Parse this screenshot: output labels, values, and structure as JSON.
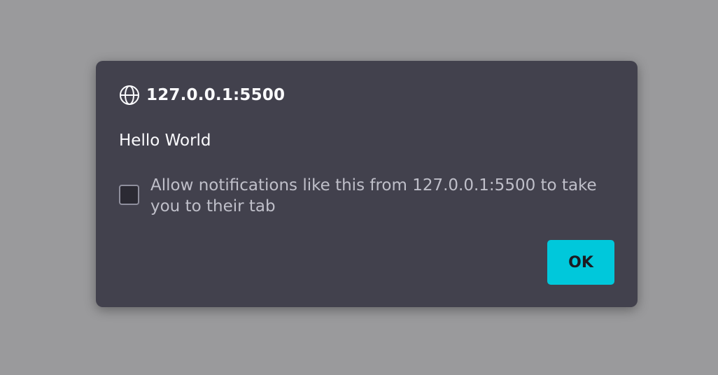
{
  "dialog": {
    "origin": "127.0.0.1:5500",
    "message": "Hello World",
    "checkbox_label": "Allow notifications like this from 127.0.0.1:5500 to take you to their tab",
    "checkbox_checked": false,
    "ok_label": "OK"
  },
  "icons": {
    "origin_icon": "globe-icon"
  },
  "colors": {
    "backdrop": "#9a9a9c",
    "dialog_background": "#42414d",
    "primary_button": "#00c8db",
    "text_primary": "#fbfbfe",
    "text_secondary": "#bfbfc9"
  }
}
